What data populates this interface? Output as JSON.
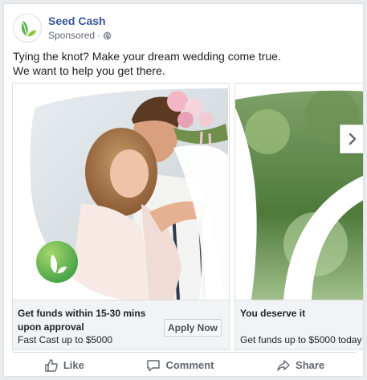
{
  "page": {
    "name": "Seed Cash",
    "sponsored": "Sponsored",
    "separator": "·",
    "avatar_icon": "seed-leaf-logo-icon",
    "privacy_icon": "globe-icon"
  },
  "post": {
    "text_line1": "Tying the knot? Make your dream wedding come true.",
    "text_line2": "We want to help you get there."
  },
  "carousel": {
    "cards": [
      {
        "image": "wedding-couple-photo",
        "headline": "Get funds within 15-30 mins upon approval",
        "description": "Fast Cast up to $5000",
        "cta": "Apply Now"
      },
      {
        "image": "green-leaf-photo",
        "headline": "You deserve it",
        "description": "Get funds up to $5000 today"
      }
    ],
    "next_icon": "chevron-right-icon"
  },
  "actions": {
    "like": "Like",
    "comment": "Comment",
    "share": "Share"
  },
  "colors": {
    "brand_link": "#385898",
    "logo_green": "#5bb44a",
    "meta_gray": "#606770"
  }
}
